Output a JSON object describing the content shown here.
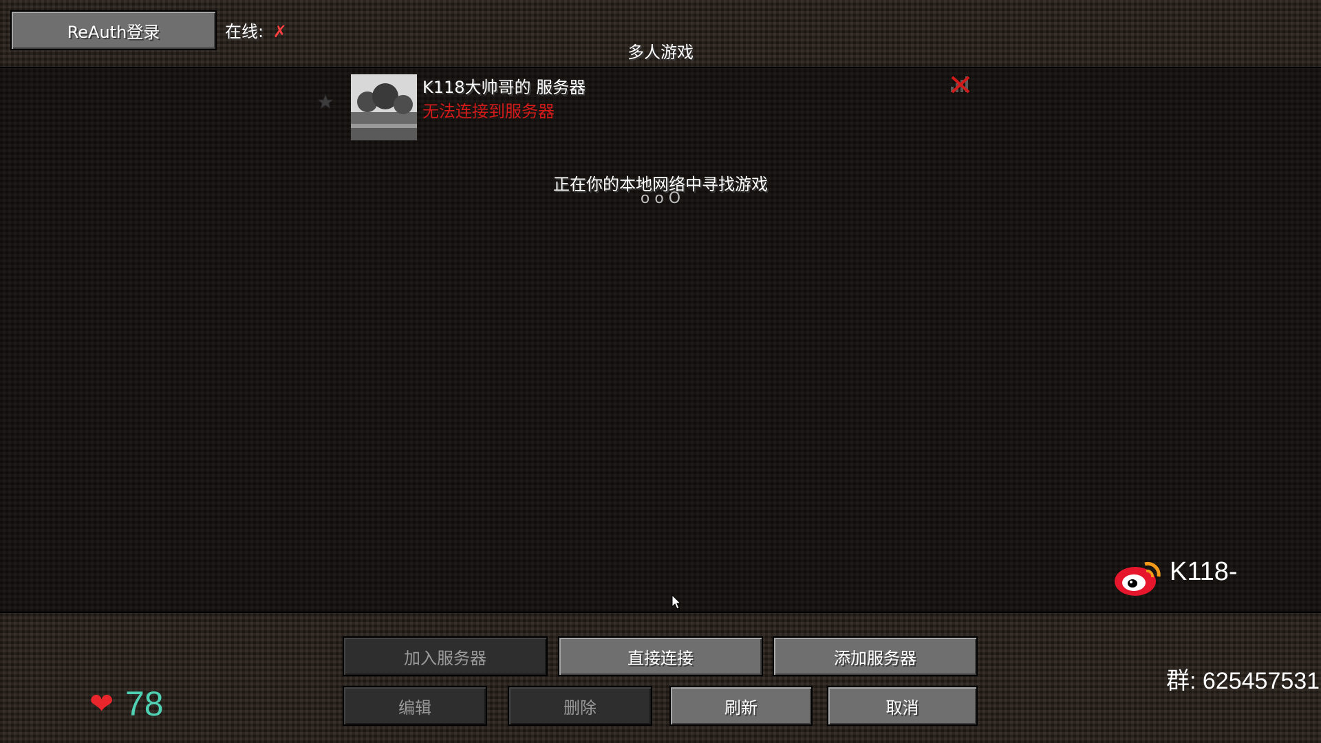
{
  "header": {
    "reauth_button": "ReAuth登录",
    "online_label": "在线:",
    "online_status": "✗",
    "title": "多人游戏"
  },
  "server": {
    "name": "K118大帅哥的 服务器",
    "status": "无法连接到服务器"
  },
  "lan": {
    "searching": "正在你的本地网络中寻找游戏",
    "dots": "o o O"
  },
  "watermark": {
    "weibo_name": "K118-",
    "group": "群: 625457531"
  },
  "likes": {
    "heart": "❤",
    "count": "78"
  },
  "buttons": {
    "join": "加入服务器",
    "direct": "直接连接",
    "add": "添加服务器",
    "edit": "编辑",
    "delete": "删除",
    "refresh": "刷新",
    "cancel": "取消"
  },
  "colors": {
    "error_red": "#d11b1b",
    "heart_red": "#e8262b",
    "count_teal": "#4fd1b4"
  }
}
